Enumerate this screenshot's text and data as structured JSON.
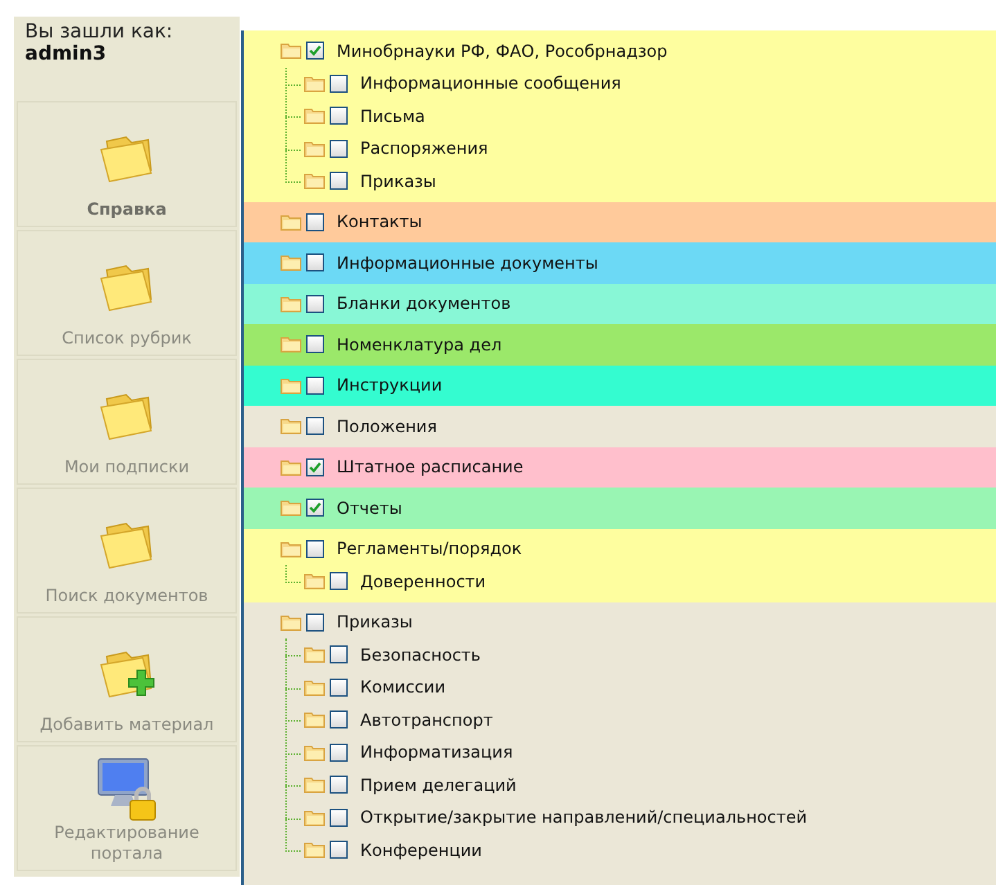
{
  "sidebar": {
    "greeting": "Вы зашли как:",
    "username": "admin3",
    "items": [
      {
        "label": "Справка",
        "kind": "folder",
        "selected": true
      },
      {
        "label": "Список рубрик",
        "kind": "folder",
        "selected": false
      },
      {
        "label": "Мои подписки",
        "kind": "folder",
        "selected": false
      },
      {
        "label": "Поиск документов",
        "kind": "folder",
        "selected": false
      },
      {
        "label": "Добавить материал",
        "kind": "folder-add",
        "selected": false
      },
      {
        "label": "Редактирование портала",
        "kind": "monitor-lock",
        "selected": false
      }
    ]
  },
  "tree": [
    {
      "label": "Минобрнауки РФ, ФАО, Рособрнадзор",
      "checked": true,
      "color": "#fefe9f",
      "children": [
        {
          "label": "Информационные сообщения",
          "checked": false
        },
        {
          "label": "Письма",
          "checked": false
        },
        {
          "label": "Распоряжения",
          "checked": false
        },
        {
          "label": "Приказы",
          "checked": false
        }
      ]
    },
    {
      "label": "Контакты",
      "checked": false,
      "color": "#ffca9b"
    },
    {
      "label": "Информационные документы",
      "checked": false,
      "color": "#6cd9f5"
    },
    {
      "label": "Бланки документов",
      "checked": false,
      "color": "#88f7d6"
    },
    {
      "label": "Номенклатура дел",
      "checked": false,
      "color": "#9be86a"
    },
    {
      "label": "Инструкции",
      "checked": false,
      "color": "#34fcd0"
    },
    {
      "label": "Положения",
      "checked": false,
      "color": "#ebe7d7"
    },
    {
      "label": "Штатное расписание",
      "checked": true,
      "color": "#ffbfcc"
    },
    {
      "label": "Отчеты",
      "checked": true,
      "color": "#99f5b3"
    },
    {
      "label": "Регламенты/порядок",
      "checked": false,
      "color": "#fefe9f",
      "children": [
        {
          "label": "Доверенности",
          "checked": false
        }
      ]
    },
    {
      "label": "Приказы",
      "checked": false,
      "color": "#ebe7d7",
      "children": [
        {
          "label": "Безопасность",
          "checked": false
        },
        {
          "label": "Комиссии",
          "checked": false
        },
        {
          "label": "Автотранспорт",
          "checked": false
        },
        {
          "label": "Информатизация",
          "checked": false
        },
        {
          "label": "Прием делегаций",
          "checked": false
        },
        {
          "label": "Открытие/закрытие направлений/специальностей",
          "checked": false
        },
        {
          "label": "Конференции",
          "checked": false
        }
      ]
    }
  ]
}
